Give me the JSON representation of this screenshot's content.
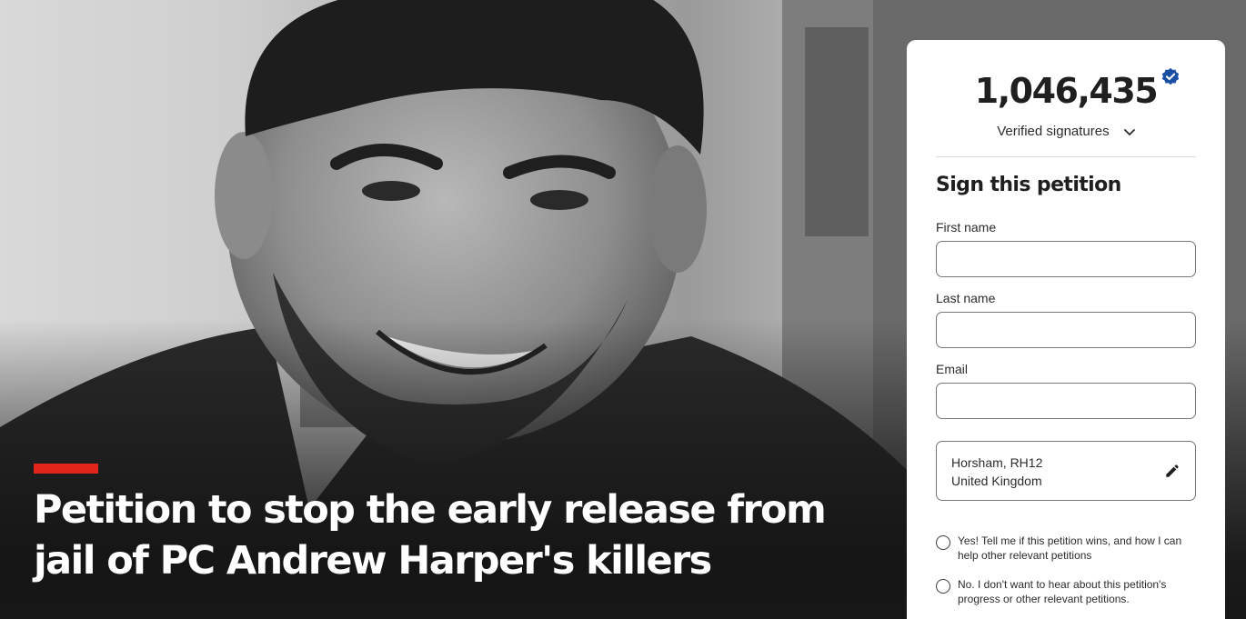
{
  "hero": {
    "title": "Petition to stop the early release from jail of PC Andrew Harper's killers",
    "accent_color": "#e1251b"
  },
  "signatures": {
    "count": "1,046,435",
    "label": "Verified signatures",
    "badge_icon": "verified-badge-icon",
    "badge_color": "#1a4fa3"
  },
  "form": {
    "title": "Sign this petition",
    "first_name": {
      "label": "First name",
      "value": ""
    },
    "last_name": {
      "label": "Last name",
      "value": ""
    },
    "email": {
      "label": "Email",
      "value": ""
    },
    "location": {
      "line1": "Horsham, RH12",
      "line2": "United Kingdom",
      "edit_icon": "pencil-icon"
    },
    "options": [
      {
        "text": "Yes! Tell me if this petition wins, and how I can help other relevant petitions"
      },
      {
        "text": "No. I don't want to hear about this petition's progress or other relevant petitions."
      }
    ]
  }
}
